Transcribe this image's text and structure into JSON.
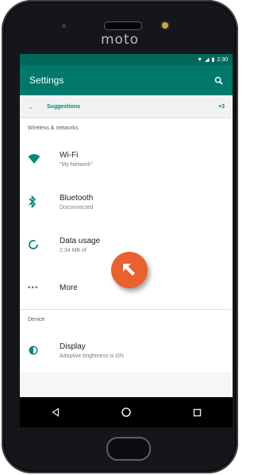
{
  "device": {
    "brand": "moto"
  },
  "status_bar": {
    "time": "2:30"
  },
  "app_bar": {
    "title": "Settings",
    "search_icon": "search-icon"
  },
  "suggestions": {
    "label": "Suggestions",
    "count": "+3",
    "icon": "chevron-down-icon"
  },
  "sections": [
    {
      "header": "Wireless & networks",
      "items": [
        {
          "title": "Wi-Fi",
          "subtitle": "\"My Network\"",
          "icon": "wifi-icon"
        },
        {
          "title": "Bluetooth",
          "subtitle": "Disconnected",
          "icon": "bluetooth-icon"
        },
        {
          "title": "Data usage",
          "subtitle": "2.34 MB of",
          "icon": "data-usage-icon"
        },
        {
          "title": "More",
          "subtitle": "",
          "icon": "more-icon"
        }
      ]
    },
    {
      "header": "Device",
      "items": [
        {
          "title": "Display",
          "subtitle": "Adaptive brightness is ON",
          "icon": "display-icon"
        }
      ]
    }
  ],
  "nav_bar": {
    "back": "back-icon",
    "home": "home-icon",
    "recents": "recents-icon"
  },
  "colors": {
    "primary": "#00796b",
    "primary_dark": "#00695c",
    "accent": "#00897b",
    "pointer": "#e8612e"
  }
}
